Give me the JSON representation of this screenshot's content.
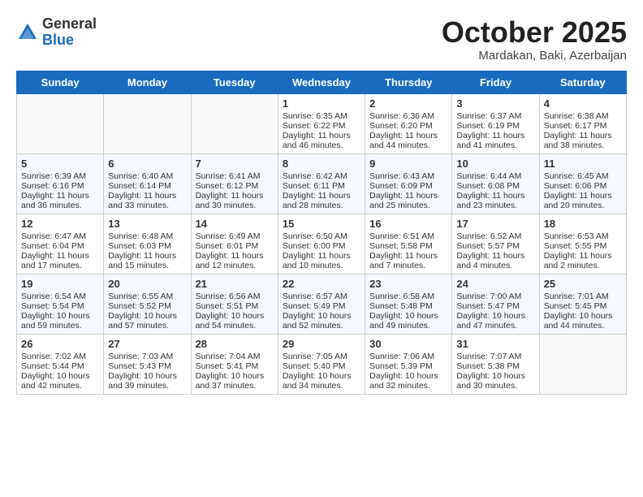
{
  "header": {
    "logo_line1": "General",
    "logo_line2": "Blue",
    "month_title": "October 2025",
    "location": "Mardakan, Baki, Azerbaijan"
  },
  "weekdays": [
    "Sunday",
    "Monday",
    "Tuesday",
    "Wednesday",
    "Thursday",
    "Friday",
    "Saturday"
  ],
  "weeks": [
    [
      {
        "day": "",
        "info": ""
      },
      {
        "day": "",
        "info": ""
      },
      {
        "day": "",
        "info": ""
      },
      {
        "day": "1",
        "info": "Sunrise: 6:35 AM\nSunset: 6:22 PM\nDaylight: 11 hours and 46 minutes."
      },
      {
        "day": "2",
        "info": "Sunrise: 6:36 AM\nSunset: 6:20 PM\nDaylight: 11 hours and 44 minutes."
      },
      {
        "day": "3",
        "info": "Sunrise: 6:37 AM\nSunset: 6:19 PM\nDaylight: 11 hours and 41 minutes."
      },
      {
        "day": "4",
        "info": "Sunrise: 6:38 AM\nSunset: 6:17 PM\nDaylight: 11 hours and 38 minutes."
      }
    ],
    [
      {
        "day": "5",
        "info": "Sunrise: 6:39 AM\nSunset: 6:16 PM\nDaylight: 11 hours and 36 minutes."
      },
      {
        "day": "6",
        "info": "Sunrise: 6:40 AM\nSunset: 6:14 PM\nDaylight: 11 hours and 33 minutes."
      },
      {
        "day": "7",
        "info": "Sunrise: 6:41 AM\nSunset: 6:12 PM\nDaylight: 11 hours and 30 minutes."
      },
      {
        "day": "8",
        "info": "Sunrise: 6:42 AM\nSunset: 6:11 PM\nDaylight: 11 hours and 28 minutes."
      },
      {
        "day": "9",
        "info": "Sunrise: 6:43 AM\nSunset: 6:09 PM\nDaylight: 11 hours and 25 minutes."
      },
      {
        "day": "10",
        "info": "Sunrise: 6:44 AM\nSunset: 6:08 PM\nDaylight: 11 hours and 23 minutes."
      },
      {
        "day": "11",
        "info": "Sunrise: 6:45 AM\nSunset: 6:06 PM\nDaylight: 11 hours and 20 minutes."
      }
    ],
    [
      {
        "day": "12",
        "info": "Sunrise: 6:47 AM\nSunset: 6:04 PM\nDaylight: 11 hours and 17 minutes."
      },
      {
        "day": "13",
        "info": "Sunrise: 6:48 AM\nSunset: 6:03 PM\nDaylight: 11 hours and 15 minutes."
      },
      {
        "day": "14",
        "info": "Sunrise: 6:49 AM\nSunset: 6:01 PM\nDaylight: 11 hours and 12 minutes."
      },
      {
        "day": "15",
        "info": "Sunrise: 6:50 AM\nSunset: 6:00 PM\nDaylight: 11 hours and 10 minutes."
      },
      {
        "day": "16",
        "info": "Sunrise: 6:51 AM\nSunset: 5:58 PM\nDaylight: 11 hours and 7 minutes."
      },
      {
        "day": "17",
        "info": "Sunrise: 6:52 AM\nSunset: 5:57 PM\nDaylight: 11 hours and 4 minutes."
      },
      {
        "day": "18",
        "info": "Sunrise: 6:53 AM\nSunset: 5:55 PM\nDaylight: 11 hours and 2 minutes."
      }
    ],
    [
      {
        "day": "19",
        "info": "Sunrise: 6:54 AM\nSunset: 5:54 PM\nDaylight: 10 hours and 59 minutes."
      },
      {
        "day": "20",
        "info": "Sunrise: 6:55 AM\nSunset: 5:52 PM\nDaylight: 10 hours and 57 minutes."
      },
      {
        "day": "21",
        "info": "Sunrise: 6:56 AM\nSunset: 5:51 PM\nDaylight: 10 hours and 54 minutes."
      },
      {
        "day": "22",
        "info": "Sunrise: 6:57 AM\nSunset: 5:49 PM\nDaylight: 10 hours and 52 minutes."
      },
      {
        "day": "23",
        "info": "Sunrise: 6:58 AM\nSunset: 5:48 PM\nDaylight: 10 hours and 49 minutes."
      },
      {
        "day": "24",
        "info": "Sunrise: 7:00 AM\nSunset: 5:47 PM\nDaylight: 10 hours and 47 minutes."
      },
      {
        "day": "25",
        "info": "Sunrise: 7:01 AM\nSunset: 5:45 PM\nDaylight: 10 hours and 44 minutes."
      }
    ],
    [
      {
        "day": "26",
        "info": "Sunrise: 7:02 AM\nSunset: 5:44 PM\nDaylight: 10 hours and 42 minutes."
      },
      {
        "day": "27",
        "info": "Sunrise: 7:03 AM\nSunset: 5:43 PM\nDaylight: 10 hours and 39 minutes."
      },
      {
        "day": "28",
        "info": "Sunrise: 7:04 AM\nSunset: 5:41 PM\nDaylight: 10 hours and 37 minutes."
      },
      {
        "day": "29",
        "info": "Sunrise: 7:05 AM\nSunset: 5:40 PM\nDaylight: 10 hours and 34 minutes."
      },
      {
        "day": "30",
        "info": "Sunrise: 7:06 AM\nSunset: 5:39 PM\nDaylight: 10 hours and 32 minutes."
      },
      {
        "day": "31",
        "info": "Sunrise: 7:07 AM\nSunset: 5:38 PM\nDaylight: 10 hours and 30 minutes."
      },
      {
        "day": "",
        "info": ""
      }
    ]
  ]
}
